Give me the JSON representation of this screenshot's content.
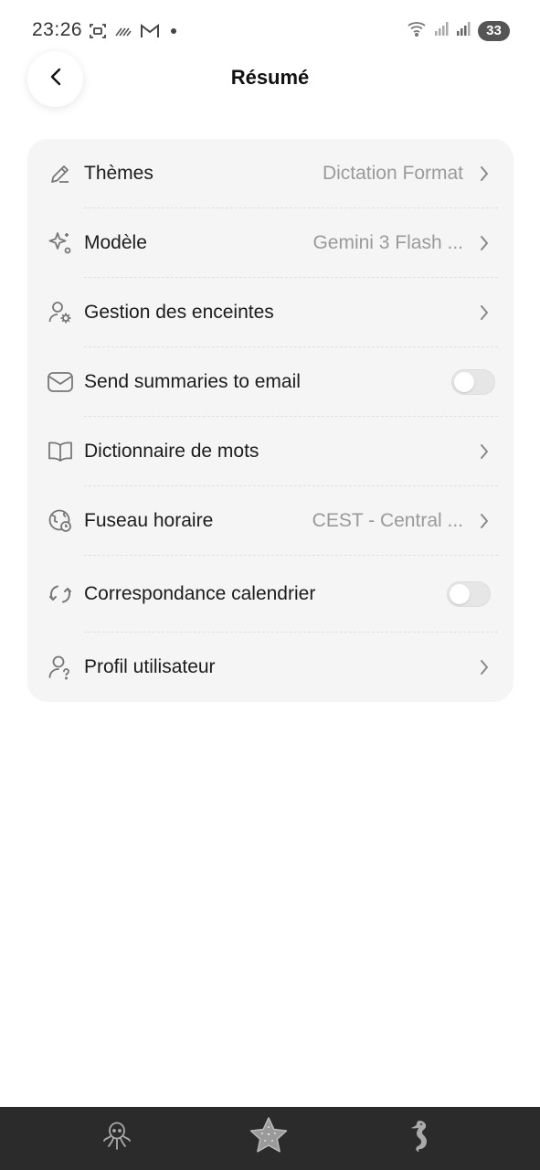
{
  "status_bar": {
    "time": "23:26",
    "battery": "33"
  },
  "header": {
    "title": "Résumé"
  },
  "settings": {
    "themes": {
      "label": "Thèmes",
      "value": "Dictation Format"
    },
    "model": {
      "label": "Modèle",
      "value": "Gemini 3 Flash ..."
    },
    "speakers": {
      "label": "Gestion des enceintes"
    },
    "email": {
      "label": "Send summaries to email",
      "enabled": false
    },
    "dictionary": {
      "label": "Dictionnaire de mots"
    },
    "timezone": {
      "label": "Fuseau horaire",
      "value": "CEST - Central ..."
    },
    "calendar": {
      "label": "Correspondance calendrier",
      "enabled": false
    },
    "profile": {
      "label": "Profil utilisateur"
    }
  },
  "bottom_nav": {
    "items": [
      {
        "icon": "octopus-icon"
      },
      {
        "icon": "starfish-icon",
        "active": true
      },
      {
        "icon": "seahorse-icon"
      }
    ]
  },
  "colors": {
    "card_background": "#f5f5f5",
    "value_text": "#9a9a9a",
    "nav_background": "#2b2b2b"
  }
}
